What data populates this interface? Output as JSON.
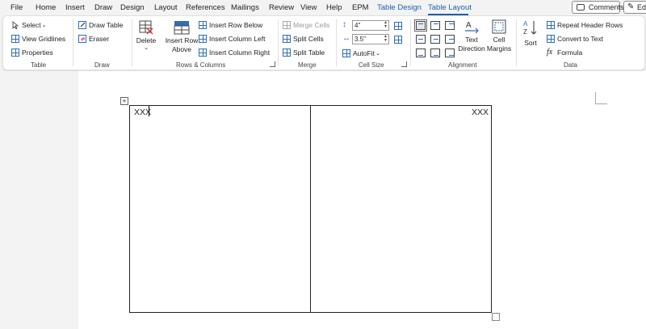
{
  "menu": {
    "tabs": [
      "File",
      "Home",
      "Insert",
      "Draw",
      "Design",
      "Layout",
      "References",
      "Mailings",
      "Review",
      "View",
      "Help",
      "EPM"
    ],
    "context_tabs": [
      "Table Design",
      "Table Layout"
    ],
    "comments_label": "Comments",
    "edit_label": "Ed"
  },
  "ribbon": {
    "table_group": {
      "label": "Table",
      "select": "Select",
      "view_gridlines": "View Gridlines",
      "properties": "Properties"
    },
    "draw_group": {
      "label": "Draw",
      "draw_table": "Draw Table",
      "eraser": "Eraser"
    },
    "rows_columns_group": {
      "label": "Rows & Columns",
      "delete": "Delete",
      "insert_row_above_line1": "Insert Row",
      "insert_row_above_line2": "Above",
      "insert_row_below": "Insert Row Below",
      "insert_column_left": "Insert Column Left",
      "insert_column_right": "Insert Column Right"
    },
    "merge_group": {
      "label": "Merge",
      "merge_cells": "Merge Cells",
      "split_cells": "Split Cells",
      "split_table": "Split Table"
    },
    "cell_size_group": {
      "label": "Cell Size",
      "height_value": "4\"",
      "width_value": "3.5\"",
      "autofit": "AutoFit"
    },
    "alignment_group": {
      "label": "Alignment",
      "text_direction_line1": "Text",
      "text_direction_line2": "Direction",
      "cell_margins_line1": "Cell",
      "cell_margins_line2": "Margins"
    },
    "data_group": {
      "label": "Data",
      "sort": "Sort",
      "repeat_header_rows": "Repeat Header Rows",
      "convert_to_text": "Convert to Text",
      "formula": "Formula"
    }
  },
  "document": {
    "cell_1_text": "XXX",
    "cell_2_text": "XXX"
  },
  "colors": {
    "accent": "#1e5fae",
    "ribbon_bg": "#ffffff",
    "app_bg": "#f3f3f3"
  }
}
